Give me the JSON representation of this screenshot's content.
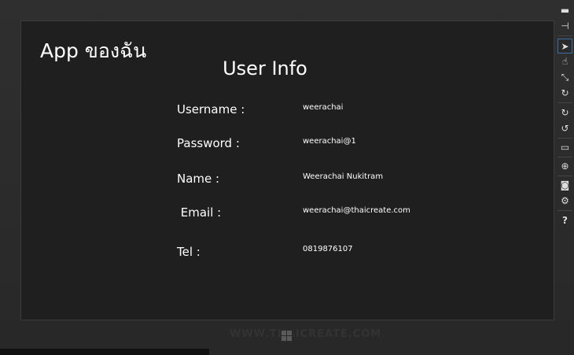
{
  "app": {
    "title": "App ของฉัน",
    "page_title": "User Info"
  },
  "fields": [
    {
      "label": "Username :",
      "value": "weerachai"
    },
    {
      "label": "Password :",
      "value": "weerachai@1"
    },
    {
      "label": "Name :",
      "value": "Weerachai Nukitram"
    },
    {
      "label": " Email :",
      "value": "weerachai@thaicreate.com"
    },
    {
      "label": "Tel :",
      "value": "0819876107"
    }
  ],
  "watermark": "WWW.THAICREATE.COM",
  "toolbar": {
    "items": [
      "minimize",
      "always-on-top",
      "mouse-mode",
      "touch-mode",
      "pinch-zoom",
      "rotate-touch",
      "rotate-clockwise",
      "rotate-counterclockwise",
      "change-resolution",
      "set-location",
      "screenshot",
      "settings",
      "help"
    ],
    "help_label": "?"
  },
  "colors": {
    "screen_bg": "#1f1f1f",
    "frame_bg": "#2c2c2c",
    "accent": "#3a6ea5"
  }
}
